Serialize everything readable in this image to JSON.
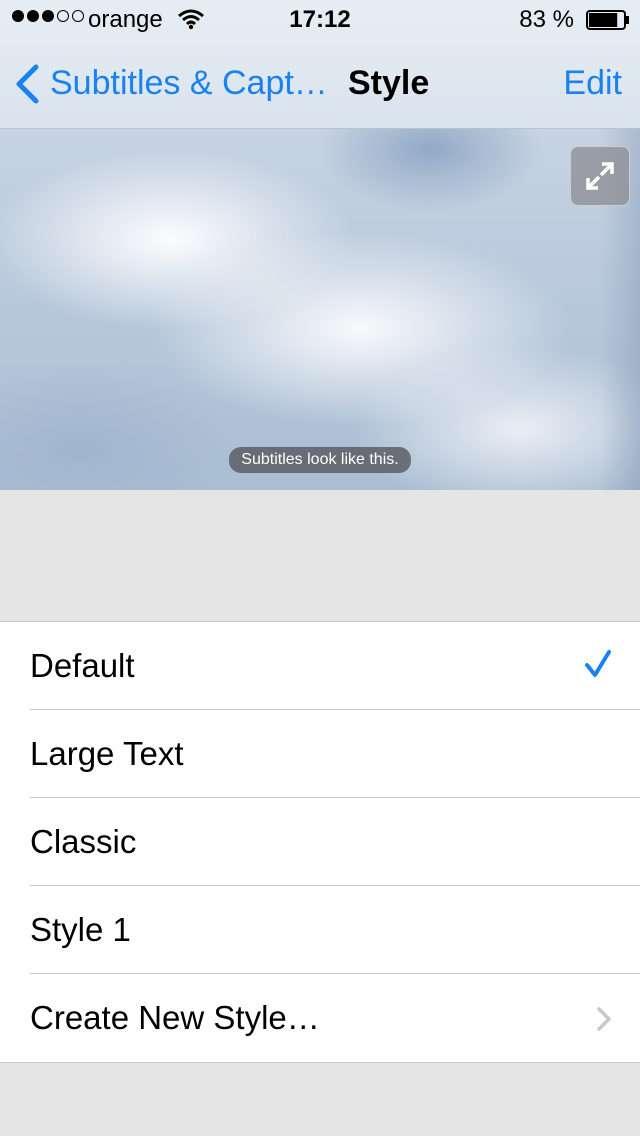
{
  "status_bar": {
    "signal_dots": [
      true,
      true,
      true,
      false,
      false
    ],
    "carrier": "orange",
    "time": "17:12",
    "battery_percent": "83 %",
    "battery_level": 0.83
  },
  "nav": {
    "back_label": "Subtitles & Capt…",
    "title": "Style",
    "edit_label": "Edit"
  },
  "preview": {
    "caption": "Subtitles look like this."
  },
  "styles": [
    {
      "label": "Default",
      "selected": true
    },
    {
      "label": "Large Text",
      "selected": false
    },
    {
      "label": "Classic",
      "selected": false
    },
    {
      "label": "Style 1",
      "selected": false
    },
    {
      "label": "Create New Style…",
      "disclosure": true
    }
  ],
  "colors": {
    "accent": "#1a82f0",
    "background": "#e5e5e5"
  }
}
